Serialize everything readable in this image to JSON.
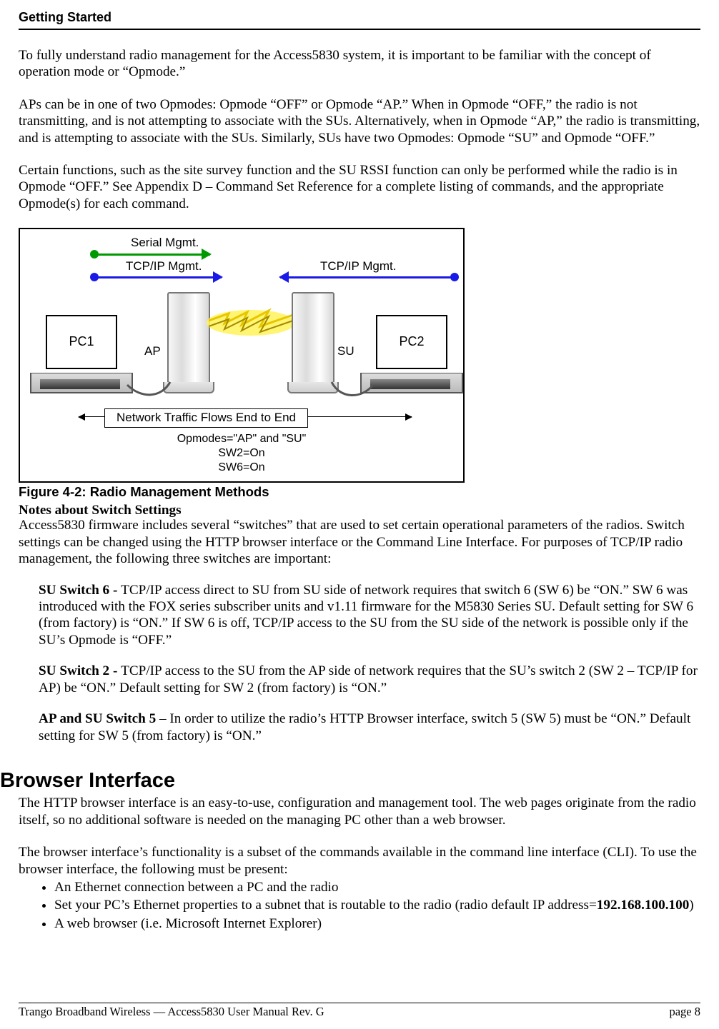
{
  "header": {
    "title": "Getting Started"
  },
  "paras": {
    "p1": "To fully understand radio management for the Access5830 system, it is important to be familiar with the concept of operation mode or “Opmode.”",
    "p2": "APs can be in one of two Opmodes: Opmode “OFF” or Opmode “AP.”   When in Opmode “OFF,” the radio is not transmitting, and is not attempting to associate with the SUs.  Alternatively, when in Opmode “AP,” the radio is transmitting, and is attempting to associate with the SUs.   Similarly, SUs have two Opmodes: Opmode “SU” and Opmode “OFF.”",
    "p3": "Certain functions, such as the site survey function and the SU RSSI function can only be performed while the radio is in Opmode “OFF.”  See Appendix D – Command Set Reference for a complete listing of commands, and the appropriate Opmode(s) for each command."
  },
  "diagram": {
    "serial": "Serial Mgmt.",
    "tcpip_left": "TCP/IP Mgmt.",
    "tcpip_right": "TCP/IP Mgmt.",
    "pc1": "PC1",
    "pc2": "PC2",
    "ap": "AP",
    "su": "SU",
    "traffic": "Network  Traffic Flows End to End",
    "opmodes": "Opmodes=\"AP\" and \"SU\"",
    "sw2": "SW2=On",
    "sw6": "SW6=On",
    "colors": {
      "green": "#009a00",
      "blue": "#1a1ae6"
    }
  },
  "figure": {
    "caption": "Figure 4-2:  Radio Management Methods",
    "notes_heading": "Notes about Switch Settings",
    "intro": "Access5830 firmware includes several “switches” that are used to set certain operational parameters of the radios.  Switch settings can be changed using the HTTP browser interface or the Command Line Interface.  For purposes of TCP/IP radio management, the following three switches are important:"
  },
  "switches": {
    "sw6": {
      "lead": "SU Switch 6 - ",
      "text": "TCP/IP access direct to SU from SU side of network requires that switch 6 (SW 6) be “ON.”  SW 6 was introduced with the FOX series subscriber units and v1.11 firmware for the M5830 Series SU.  Default setting for SW 6 (from factory) is “ON.”  If SW 6 is off, TCP/IP access to the SU from the SU side of the network is possible only if the SU’s Opmode is “OFF.”"
    },
    "sw2": {
      "lead": "SU Switch 2 - ",
      "text": "TCP/IP access to the SU from the AP side of network requires that the SU’s switch 2 (SW 2 – TCP/IP for AP) be “ON.”  Default setting for SW 2 (from factory) is “ON.”"
    },
    "sw5": {
      "lead": "AP and SU Switch 5",
      "text": " – In order to utilize the radio’s HTTP Browser interface, switch 5 (SW 5) must be “ON.”  Default setting for SW 5 (from factory) is “ON.”"
    }
  },
  "browser": {
    "heading": "Browser Interface",
    "p1": "The HTTP browser interface is an easy-to-use, configuration and management tool.  The web pages originate from the radio itself, so no additional software is needed on the managing PC other than a web browser.",
    "p2": "The browser interface’s functionality is a subset of the commands available in the command line interface (CLI).  To use the browser interface, the following must be present:",
    "bullets": {
      "b1": "An Ethernet connection between a PC and the radio",
      "b2_pre": "Set your PC’s Ethernet properties to a subnet that is routable to the radio (radio default IP address=",
      "b2_ip": "192.168.100.100",
      "b2_post": ")",
      "b3": "A web browser (i.e. Microsoft Internet Explorer)"
    }
  },
  "footer": {
    "left": "Trango Broadband Wireless — Access5830 User Manual  Rev. G",
    "right": "page 8"
  }
}
